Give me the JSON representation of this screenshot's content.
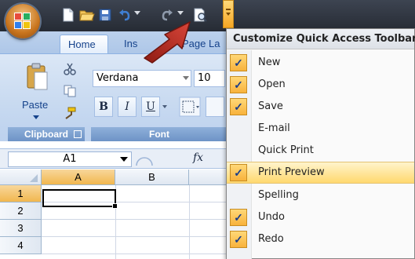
{
  "qat": {
    "icons": [
      "new-icon",
      "open-icon",
      "save-icon",
      "undo-icon",
      "redo-icon",
      "print-preview-icon"
    ],
    "customize_icon": "customize-dropdown-icon"
  },
  "tabs": [
    {
      "label": "Home",
      "active": true
    },
    {
      "label": "Ins",
      "active": false
    },
    {
      "label": "Page La",
      "active": false
    }
  ],
  "ribbon": {
    "clipboard": {
      "paste_label": "Paste",
      "group_label": "Clipboard"
    },
    "font": {
      "font_name": "Verdana",
      "font_size": "10",
      "bold": "B",
      "italic": "I",
      "underline": "U",
      "group_label": "Font"
    }
  },
  "formula_bar": {
    "name_box": "A1",
    "fx": "fx"
  },
  "grid": {
    "columns": [
      "A",
      "B"
    ],
    "rows": [
      "1",
      "2",
      "3",
      "4"
    ],
    "active_cell": "A1"
  },
  "menu": {
    "title": "Customize Quick Access Toolbar",
    "items": [
      {
        "label": "New",
        "checked": true
      },
      {
        "label": "Open",
        "checked": true
      },
      {
        "label": "Save",
        "checked": true
      },
      {
        "label": "E-mail",
        "checked": false
      },
      {
        "label": "Quick Print",
        "checked": false
      },
      {
        "label": "Print Preview",
        "checked": true,
        "highlighted": true
      },
      {
        "label": "Spelling",
        "checked": false
      },
      {
        "label": "Undo",
        "checked": true
      },
      {
        "label": "Redo",
        "checked": true
      }
    ],
    "check_glyph": "✓"
  },
  "colors": {
    "ribbon_blue": "#c7d9f0",
    "highlight_gold": "#ffd86e",
    "arrow_red": "#c0392b"
  }
}
